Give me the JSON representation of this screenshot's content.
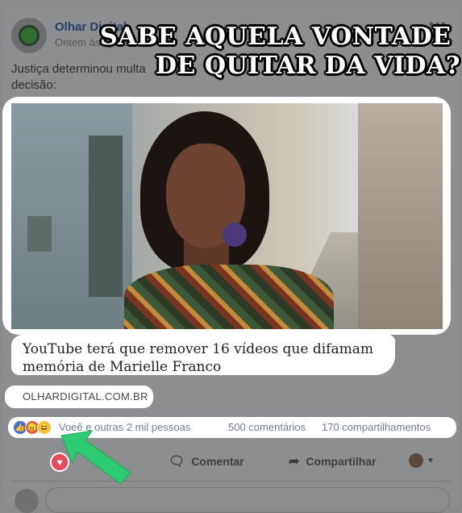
{
  "post": {
    "page_name": "Olhar Digital",
    "time": "Ontem às 18:30",
    "text": "Justiça determinou multa",
    "text_line2": "decisão:"
  },
  "meme": {
    "line1": "SABE AQUELA VONTADE",
    "line2": "DE QUITAR DA VIDA?"
  },
  "link": {
    "title": "YouTube terá que remover 16 vídeos que difamam memória de Marielle Franco",
    "domain": "OLHARDIGITAL.COM.BR"
  },
  "engagement": {
    "reaction_names": "Voeê e outras 2 mil pessoas",
    "comments": "500 comentários",
    "shares": "170 compartilhamentos"
  },
  "actions": {
    "comment_label": "Comentar",
    "share_label": "Compartilhar"
  },
  "colors": {
    "arrow": "#2ecc71",
    "like": "#3b6fd8",
    "love": "#e64a5a"
  }
}
